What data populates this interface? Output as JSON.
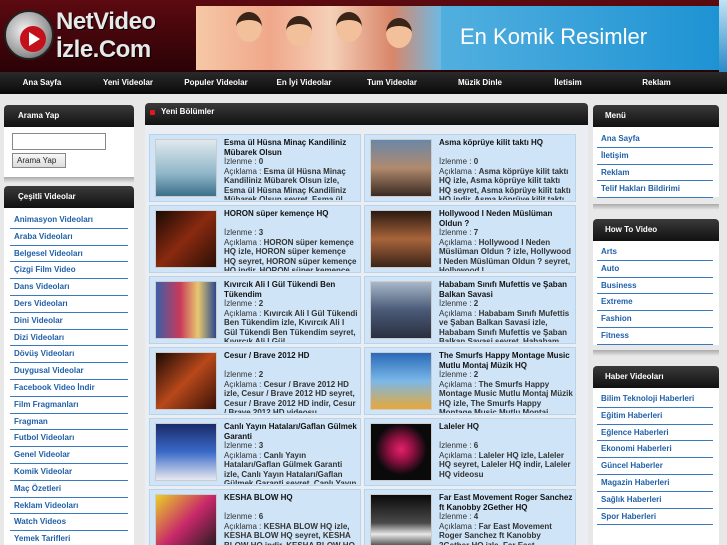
{
  "logo": {
    "line1": "NetVideo",
    "line2": "İzle.Com"
  },
  "banner": {
    "text": "En Komik Resimler"
  },
  "nav": [
    "Ana Sayfa",
    "Yeni Videolar",
    "Populer Videolar",
    "En İyi Videolar",
    "Tum Videolar",
    "Müzik Dinle",
    "İletisim",
    "Reklam"
  ],
  "search": {
    "title": "Arama Yap",
    "button": "Arama Yap",
    "value": ""
  },
  "categories": {
    "title": "Çeşitli Videolar",
    "items": [
      "Animasyon Videoları",
      "Araba Videoları",
      "Belgesel Videoları",
      "Çizgi Film Video",
      "Dans Videoları",
      "Ders Videoları",
      "Dini Videolar",
      "Dizi Videoları",
      "Dövüş Videoları",
      "Duygusal Videolar",
      "Facebook Video İndir",
      "Film Fragmanları",
      "Fragman",
      "Futbol Videoları",
      "Genel Videolar",
      "Komik Videolar",
      "Maç Özetleri",
      "Reklam Videoları",
      "Watch Videos",
      "Yemek Tarifleri"
    ]
  },
  "main": {
    "title": "Yeni Bölümler",
    "views_label": "İzlenme :",
    "desc_label": "Açıklama :",
    "videos": [
      {
        "title": "Esma ül Hüsna Minaç Kandiliniz Mübarek Olsun",
        "views": "0",
        "desc": "Esma ül Hüsna Minaç Kandiliniz Mübarek Olsun izle, Esma ül Hüsna Minaç Kandiliniz Mübarek Olsun seyret, Esma ül"
      },
      {
        "title": "Asma köprüye kilit taktı HQ",
        "views": "0",
        "desc": "Asma köprüye kilit taktı HQ izle, Asma köprüye kilit taktı HQ seyret, Asma köprüye kilit taktı HQ indir, Asma köprüye kilit taktı HQ videosu"
      },
      {
        "title": "HORON süper kemençe HQ",
        "views": "3",
        "desc": "HORON süper kemençe HQ izle, HORON süper kemençe HQ seyret, HORON süper kemençe HQ indir, HORON süper kemençe HQ videosu"
      },
      {
        "title": "Hollywood I Neden Müslüman Oldun ?",
        "views": "7",
        "desc": "Hollywood I Neden Müslüman Oldun ? izle, Hollywood I Neden Müslüman Oldun ? seyret, Hollywood I"
      },
      {
        "title": "Kıvırcık Ali I Gül Tükendi Ben Tükendim",
        "views": "2",
        "desc": "Kıvırcık Ali I Gül Tükendi Ben Tükendim izle, Kıvırcık Ali I Gül Tükendi Ben Tükendim seyret, Kıvırcık Ali I Gül"
      },
      {
        "title": "Hababam Sınıfı Mufettis ve Şaban Balkan Savasi",
        "views": "2",
        "desc": "Hababam Sınıfı Mufettis ve Şaban Balkan Savasi izle, Hababam Sınıfı Mufettis ve Şaban Balkan Savasi seyret, Hababam"
      },
      {
        "title": "Cesur / Brave 2012 HD",
        "views": "2",
        "desc": "Cesur / Brave 2012 HD izle, Cesur / Brave 2012 HD seyret, Cesur / Brave 2012 HD indir, Cesur / Brave 2012 HD videosu"
      },
      {
        "title": "The Smurfs Happy Montage Music Mutlu Montaj Müzik HQ",
        "views": "2",
        "desc": "The Smurfs Happy Montage Music Mutlu Montaj Müzik HQ izle, The Smurfs Happy Montage Music Mutlu Montaj"
      },
      {
        "title": "Canlı Yayın Hataları/Gaflan Gülmek Garanti",
        "views": "3",
        "desc": "Canlı Yayın Hataları/Gaflan Gülmek Garanti izle, Canlı Yayın Hataları/Gaflan Gülmek Garanti seyret, Canlı Yayın"
      },
      {
        "title": "Laleler HQ",
        "views": "6",
        "desc": "Laleler HQ izle, Laleler HQ seyret, Laleler HQ indir, Laleler HQ videosu"
      },
      {
        "title": "KESHA BLOW HQ",
        "views": "6",
        "desc": "KESHA BLOW HQ izle, KESHA BLOW HQ seyret, KESHA BLOW HQ indir, KESHA BLOW HQ videosu"
      },
      {
        "title": "Far East Movement Roger Sanchez ft Kanobby 2Gether HQ",
        "views": "4",
        "desc": "Far East Movement Roger Sanchez ft Kanobby 2Gether HQ izle, Far East"
      }
    ]
  },
  "menu": {
    "title": "Menü",
    "items": [
      "Ana Sayfa",
      "İletişim",
      "Reklam",
      "Telif Hakları Bildirimi"
    ]
  },
  "howto": {
    "title": "How To Video",
    "items": [
      "Arts",
      "Auto",
      "Business",
      "Extreme",
      "Fashion",
      "Fitness"
    ]
  },
  "news": {
    "title": "Haber Videoları",
    "items": [
      "Bilim Teknoloji Haberleri",
      "Eğitim Haberleri",
      "Eğlence Haberleri",
      "Ekonomi Haberleri",
      "Güncel Haberler",
      "Magazin Haberleri",
      "Sağlık Haberleri",
      "Spor Haberleri"
    ]
  },
  "colors": {
    "link": "#1f5fa8",
    "card_bg": "#cfe4f6",
    "header_bg": "#3a0509",
    "banner_blue": "#1e93d3"
  }
}
